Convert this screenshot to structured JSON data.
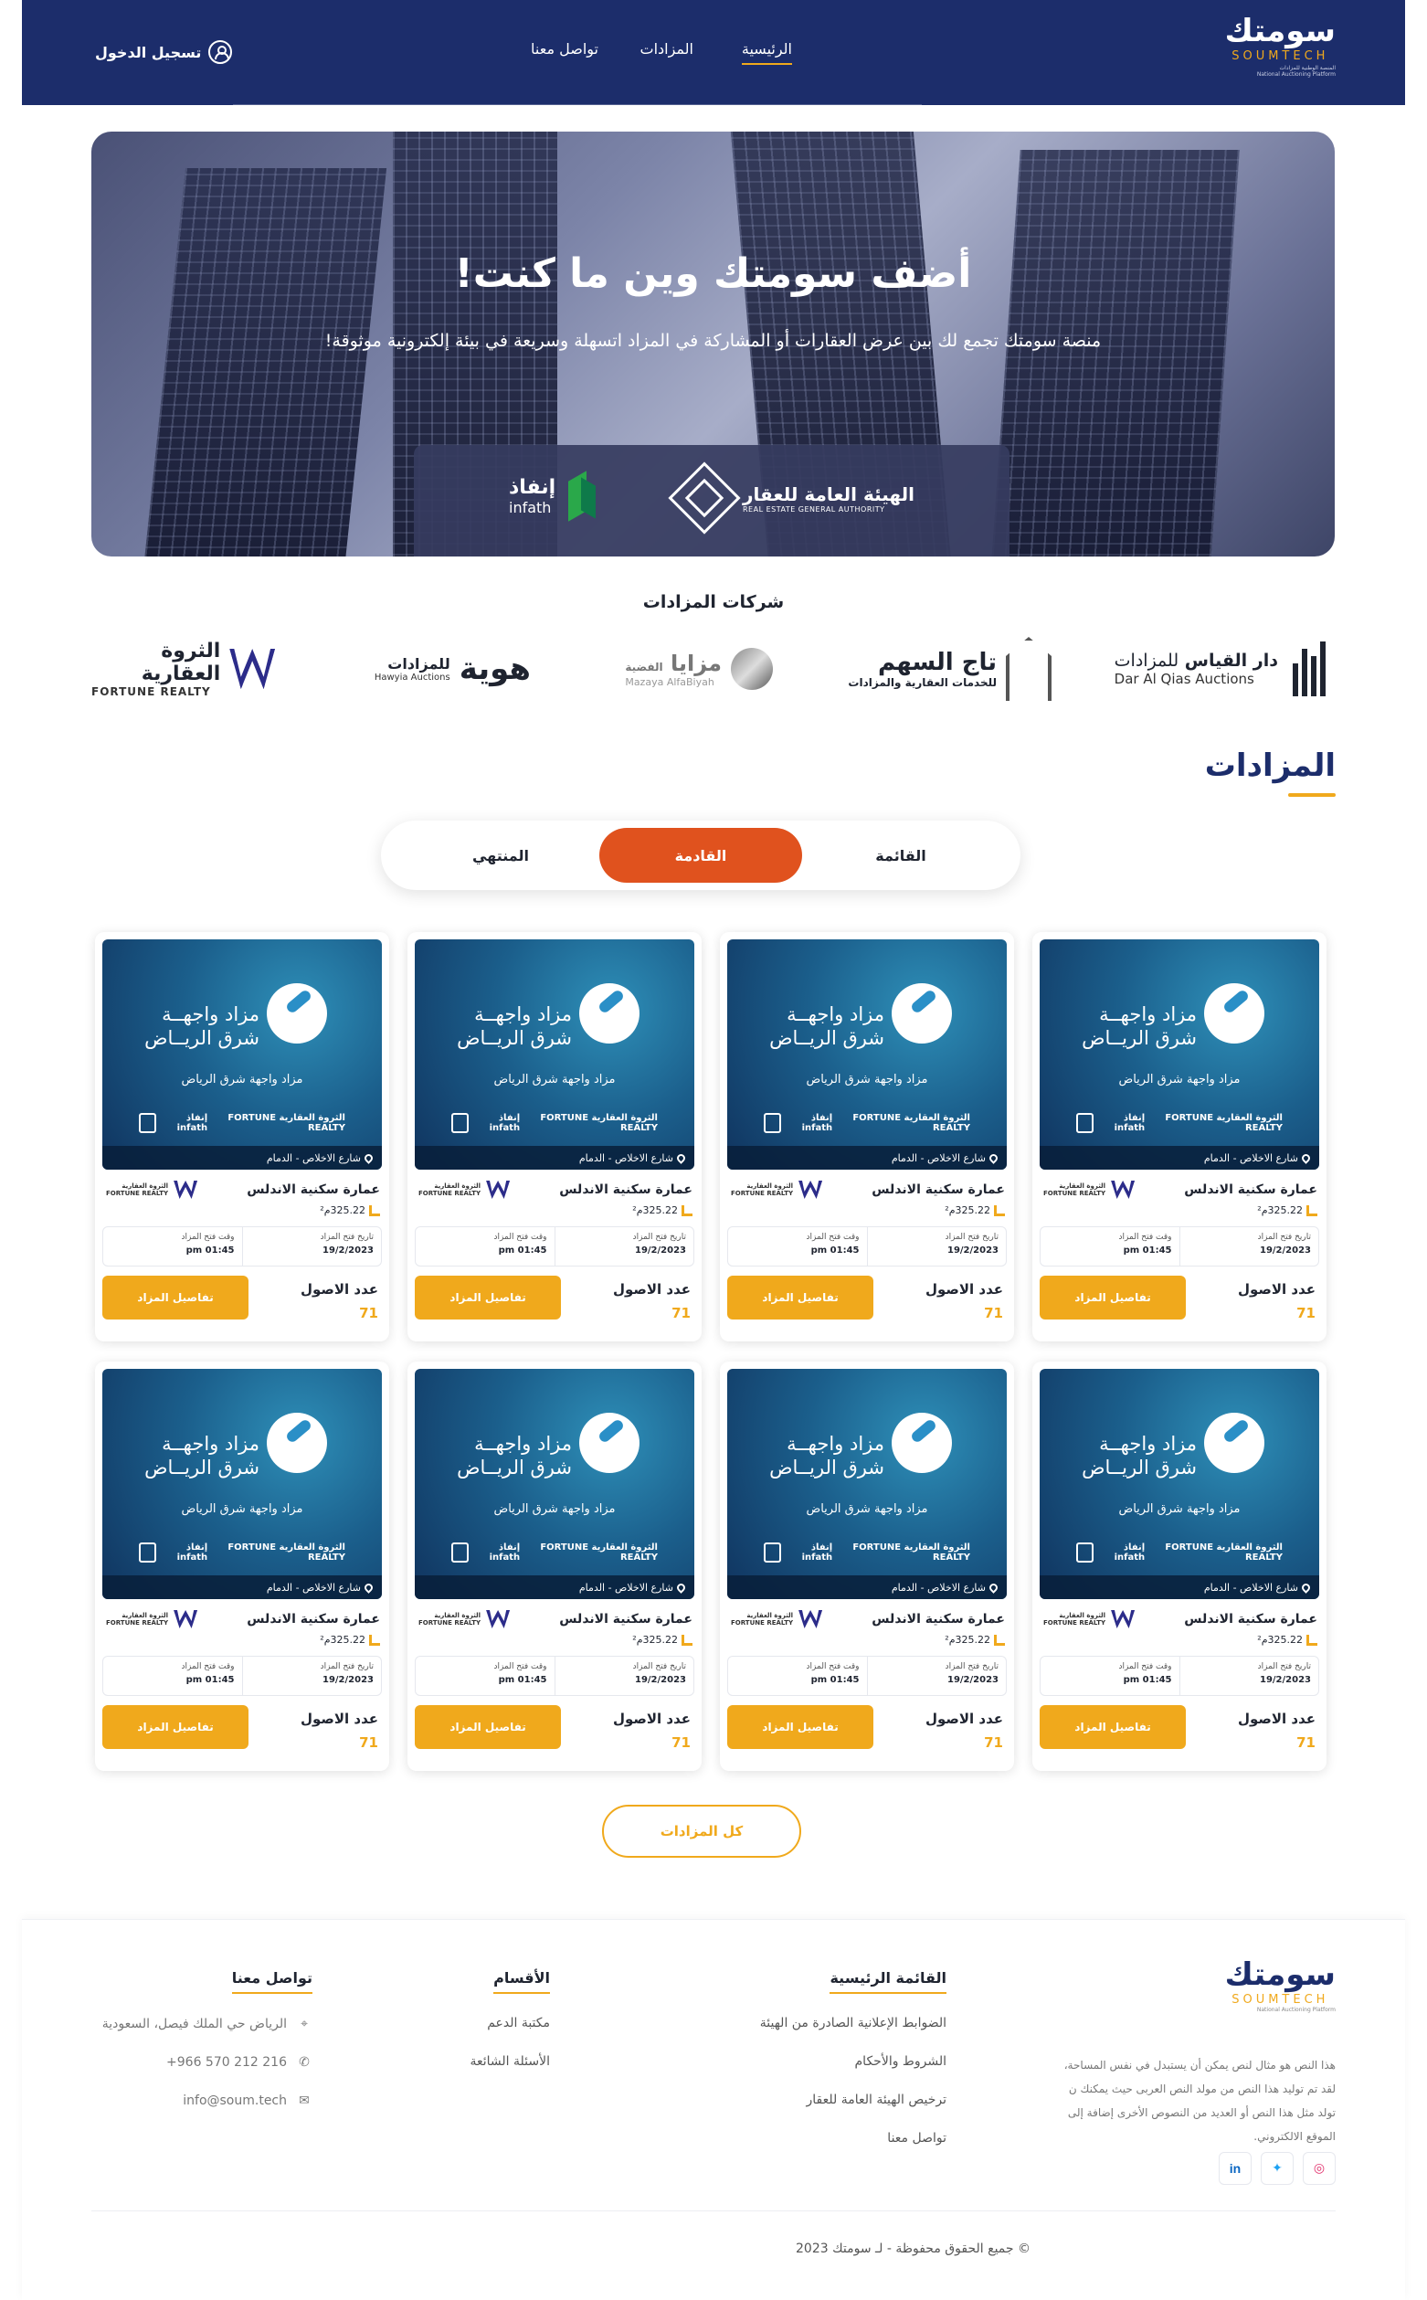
{
  "header": {
    "logo_ar": "سومتك",
    "logo_en": "SOUMTECH",
    "logo_sub_ar": "المنصة الوطنية للمزادات",
    "logo_sub_en": "National Auctioning Platform",
    "nav": [
      {
        "label": "الرئيسية",
        "active": true
      },
      {
        "label": "المزادات",
        "active": false
      },
      {
        "label": "تواصل معنا",
        "active": false
      }
    ],
    "login_label": "تسجيل الدخول"
  },
  "hero": {
    "title": "أضف سومتك وين ما كنت!",
    "subtitle": "منصة سومتك تجمع لك بين عرض العقارات أو المشاركة في المزاد اتسهلة وسريعة في بيئة إلكترونية موثوقة!",
    "rega_ar": "الهيئة العامة للعقار",
    "rega_en": "REAL ESTATE GENERAL AUTHORITY",
    "infath_ar": "إنفاذ",
    "infath_en": "infath"
  },
  "companies": {
    "title": "شركات المزادات",
    "items": [
      {
        "ar": "دار القياس",
        "ar2": "للمزادات",
        "en": "Dar Al Qias Auctions"
      },
      {
        "ar": "تاج السهم",
        "ar2": "للخدمات العقارية والمزادات",
        "en": ""
      },
      {
        "ar": "مزايا",
        "ar2": "الفضية",
        "en": "Mazaya AlfaBiyah"
      },
      {
        "ar": "هوية",
        "ar2": "للمزادات",
        "en": "Hawyia Auctions"
      },
      {
        "ar": "الثروة العقارية",
        "ar2": "",
        "en": "FORTUNE REALTY"
      }
    ]
  },
  "auctions": {
    "title": "المزادات",
    "tabs": [
      {
        "label": "القائمة",
        "active": false
      },
      {
        "label": "القادمة",
        "active": true
      },
      {
        "label": "المنتهي",
        "active": false
      }
    ],
    "card": {
      "image_title_1": "مزاد واجهــة",
      "image_title_2": "شرق الريــاض",
      "image_subtitle": "مزاد واجهة شرق الرياض",
      "image_logo_1": "إنفاذ infath",
      "image_logo_2": "الثروة العقارية FORTUNE REALTY",
      "address": "شارع الاخلاص - الدمام",
      "name": "عمارة سكنية الاندلس",
      "area": "325.22م²",
      "company_ar": "الثروة العقارية",
      "company_en": "FORTUNE REALTY",
      "open_date_label": "تاريخ فتح المزاد",
      "open_date": "19/2/2023",
      "open_time_label": "وقت فتح المزاد",
      "open_time": "01:45 pm",
      "assets_label": "عدد الاصول",
      "assets_count": "71",
      "details_label": "تفاصيل المزاد"
    },
    "all_label": "كل المزادات"
  },
  "footer": {
    "logo_ar": "سومتك",
    "logo_en": "SOUMTECH",
    "logo_sub": "National Auctioning Platform",
    "about": "هذا النص هو مثال لنص يمكن أن يستبدل في نفس المساحة، لقد تم توليد هذا النص من مولد النص العربى حيث يمكنك ن تولد مثل هذا النص أو العديد من النصوص الأخرى إضافة إلى الموقع الالكتروني.",
    "main_menu_title": "القائمة الرئيسية",
    "main_menu": [
      "الضوابط الإعلانية الصادرة من الهيئة",
      "الشروط والأحكام",
      "ترخيص الهيئة العامة للعقار",
      "تواصل معنا"
    ],
    "sections_title": "الأقسام",
    "sections": [
      "مكتبة الدعم",
      "الأسئلة الشائعة"
    ],
    "contact_title": "تواصل معنا",
    "contact_address": "الرياض حي الملك فيصل، السعودية",
    "contact_phone": "+966 570 212 216",
    "contact_email": "info@soum.tech",
    "copyright": "© جميع الحقوق محفوظة - لـ سومتك 2023"
  },
  "colors": {
    "brand_navy": "#1c2d6b",
    "accent_orange": "#e0521e",
    "accent_gold": "#f0a91c"
  }
}
